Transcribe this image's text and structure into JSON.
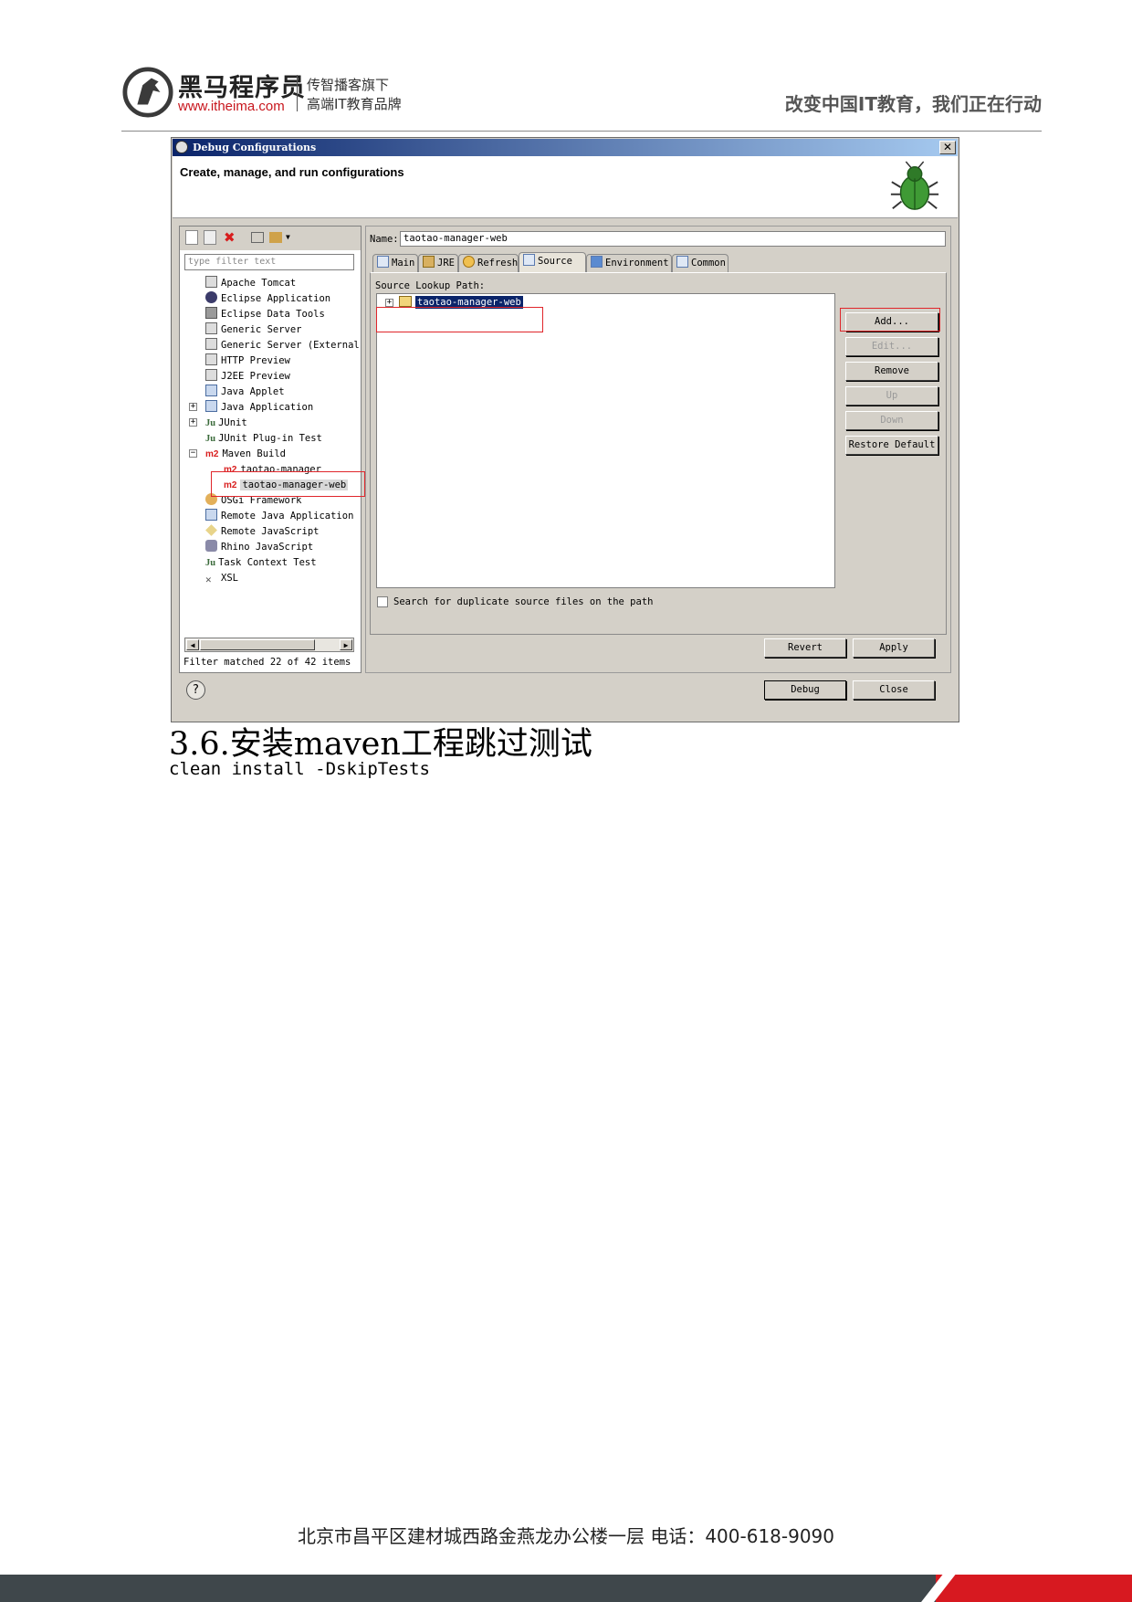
{
  "header": {
    "brand_name": "黑马程序员",
    "brand_url": "www.itheima.com",
    "tagline_line1": "传智播客旗下",
    "tagline_line2": "高端IT教育品牌",
    "slogan": "改变中国IT教育，我们正在行动"
  },
  "dialog": {
    "title": "Debug Configurations",
    "close_label": "✕",
    "banner_text": "Create, manage, and run configurations",
    "filter_placeholder": "type filter text",
    "tree": [
      {
        "label": "Apache Tomcat"
      },
      {
        "label": "Eclipse Application"
      },
      {
        "label": "Eclipse Data Tools"
      },
      {
        "label": "Generic Server"
      },
      {
        "label": "Generic Server (External"
      },
      {
        "label": "HTTP Preview"
      },
      {
        "label": "J2EE Preview"
      },
      {
        "label": "Java Applet"
      },
      {
        "label": "Java Application"
      },
      {
        "label": "JUnit"
      },
      {
        "label": "JUnit Plug-in Test"
      },
      {
        "label": "Maven Build"
      },
      {
        "label": "taotao-manager"
      },
      {
        "label": "taotao-manager-web"
      },
      {
        "label": "OSGi Framework"
      },
      {
        "label": "Remote Java Application"
      },
      {
        "label": "Remote JavaScript"
      },
      {
        "label": "Rhino JavaScript"
      },
      {
        "label": "Task Context Test"
      },
      {
        "label": "XSL"
      }
    ],
    "m2_badge": "m2",
    "ju_badge": "Ju",
    "filter_status": "Filter matched 22 of 42 items",
    "name_label": "Name:",
    "name_value": "taotao-manager-web",
    "tabs": [
      "Main",
      "JRE",
      "Refresh",
      "Source",
      "Environment",
      "Common"
    ],
    "active_tab": "Source",
    "source_lookup_label": "Source Lookup Path:",
    "source_item": "taotao-manager-web",
    "buttons": {
      "add": "Add...",
      "edit": "Edit...",
      "remove": "Remove",
      "up": "Up",
      "down": "Down",
      "restore": "Restore Default",
      "revert": "Revert",
      "apply": "Apply",
      "debug": "Debug",
      "close": "Close"
    },
    "duplicate_checkbox_label": "Search for duplicate source files on the path",
    "duplicate_checked": false,
    "help_label": "?"
  },
  "section": {
    "heading": "3.6.安装maven工程跳过测试",
    "command": "clean install -DskipTests"
  },
  "footer": {
    "address": "北京市昌平区建材城西路金燕龙办公楼一层   电话：400-618-9090"
  },
  "colors": {
    "brand_red": "#d71920",
    "footer_dark": "#3f474b",
    "highlight_red": "#e0262b",
    "selection_blue": "#0a246a"
  }
}
